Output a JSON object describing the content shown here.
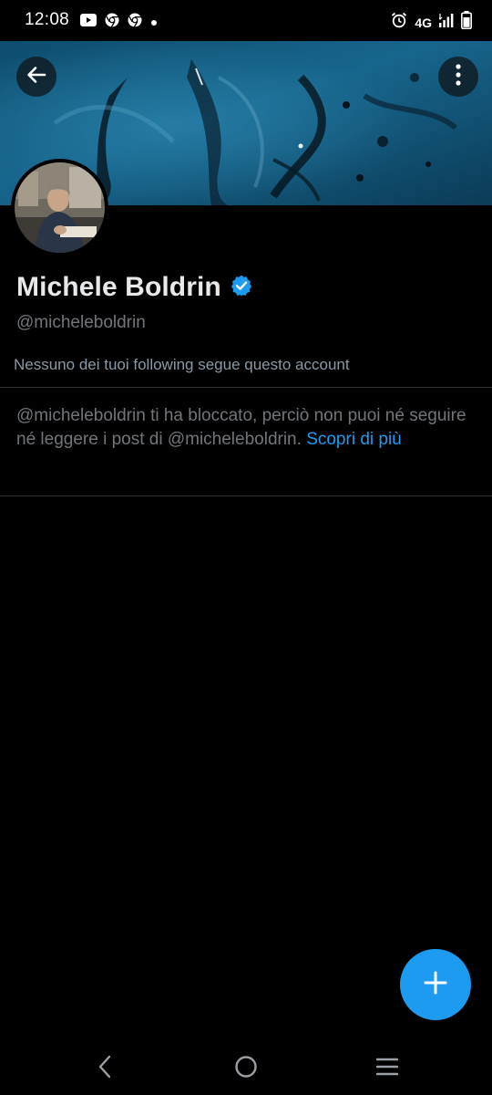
{
  "status_bar": {
    "time": "12:08",
    "network": "4G",
    "notification_icons": [
      "youtube-icon",
      "chrome-icon",
      "chrome-icon",
      "dot-icon"
    ],
    "right_icons": [
      "alarm-icon",
      "signal-icon",
      "battery-icon"
    ]
  },
  "header": {
    "back_icon": "arrow-left-icon",
    "more_icon": "more-vertical-icon"
  },
  "profile": {
    "display_name": "Michele Boldrin",
    "verified": true,
    "handle": "@micheleboldrin",
    "followers_you_know": "Nessuno dei tuoi following segue questo account"
  },
  "blocked_notice": {
    "message": "@micheleboldrin ti ha bloccato, perciò non puoi né seguire né leggere i post di @micheleboldrin.",
    "link_text": "Scopri di più"
  },
  "fab": {
    "icon": "plus-icon"
  },
  "nav_bar": {
    "icons": [
      "nav-back-icon",
      "nav-home-icon",
      "nav-menu-icon"
    ]
  },
  "colors": {
    "background": "#000000",
    "accent": "#1d9bf0",
    "primary_text": "#e7e9ea",
    "secondary_text": "#71767b",
    "divider": "#2f3336"
  }
}
